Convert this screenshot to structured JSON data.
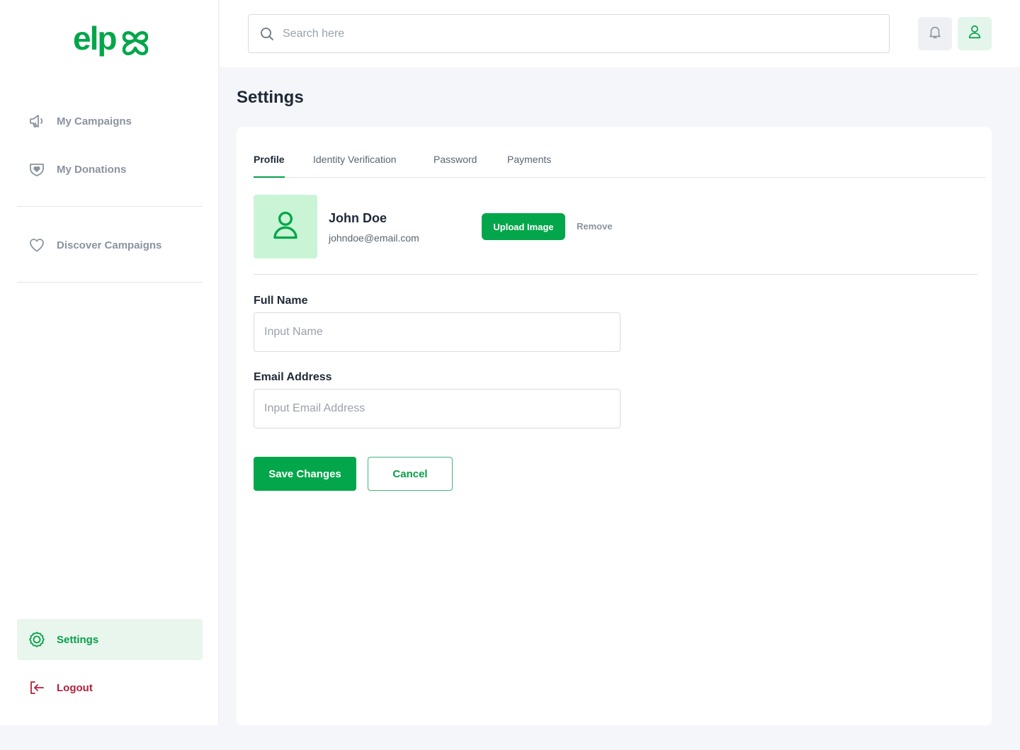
{
  "brand": {
    "logo_text": "elp",
    "accent": "#03a64a",
    "accent_light": "#e8f6ee",
    "danger": "#b3213a"
  },
  "sidebar": {
    "items": [
      {
        "label": "My Campaigns",
        "icon": "megaphone-icon"
      },
      {
        "label": "My Donations",
        "icon": "donation-heart-icon"
      },
      {
        "label": "Discover Campaigns",
        "icon": "heart-icon"
      }
    ],
    "settings": {
      "label": "Settings",
      "icon": "gear-icon",
      "active": true
    },
    "logout": {
      "label": "Logout",
      "icon": "logout-icon"
    }
  },
  "topbar": {
    "search_placeholder": "Search here",
    "notifications_icon": "bell-icon",
    "profile_icon": "user-icon"
  },
  "page": {
    "title": "Settings"
  },
  "tabs": [
    {
      "label": "Profile",
      "active": true
    },
    {
      "label": "Identity Verification",
      "active": false
    },
    {
      "label": "Password",
      "active": false
    },
    {
      "label": "Payments",
      "active": false
    }
  ],
  "profile": {
    "name": "John Doe",
    "email": "johndoe@email.com",
    "upload_label": "Upload Image",
    "remove_label": "Remove"
  },
  "form": {
    "full_name": {
      "label": "Full Name",
      "placeholder": "Input Name",
      "value": ""
    },
    "email": {
      "label": "Email Address",
      "placeholder": "Input Email Address",
      "value": ""
    }
  },
  "actions": {
    "save_label": "Save Changes",
    "cancel_label": "Cancel"
  }
}
